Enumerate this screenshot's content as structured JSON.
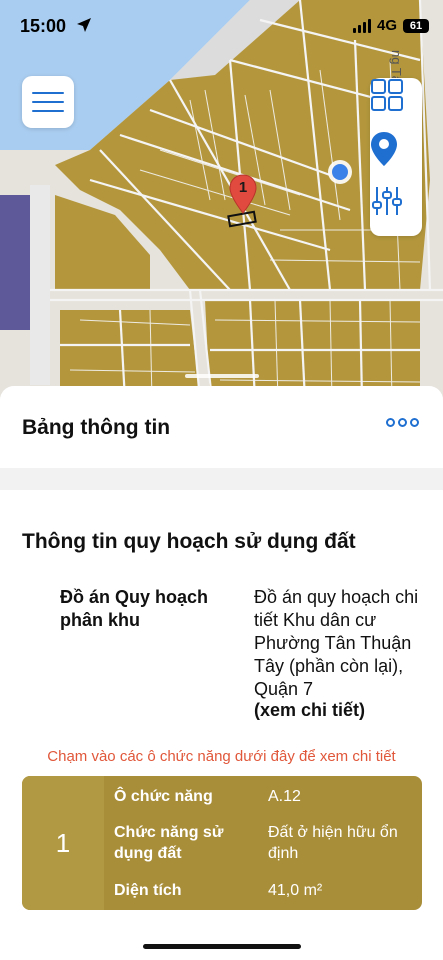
{
  "status_bar": {
    "time": "15:00",
    "network": "4G",
    "battery": "61"
  },
  "map": {
    "street_label": "ng Tân Mỹ",
    "marker_number": "1",
    "colors": {
      "land": "#b4973d",
      "water": "#a9cdf0",
      "road": "#f4f4f4",
      "marker": "#e14b3f",
      "location_dot": "#3a82e8"
    }
  },
  "toolbar": {
    "menu_icon": "hamburger-icon",
    "layers_icon": "grid-icon",
    "location_icon": "location-pin-icon",
    "filter_icon": "sliders-icon"
  },
  "panel": {
    "title": "Bảng thông tin",
    "more_icon": "ellipsis-icon"
  },
  "land_use": {
    "section_title": "Thông tin quy hoạch sử dụng đất",
    "plan_label": "Đồ án Quy hoạch phân khu",
    "plan_value": "Đồ án quy hoạch chi tiết Khu dân cư Phường Tân Thuận Tây (phần còn lại), Quận 7",
    "detail_link": "(xem chi tiết)",
    "hint": "Chạm vào các ô chức năng dưới đây để xem chi tiết"
  },
  "function_card": {
    "index": "1",
    "color": "#a98e3a",
    "rows": [
      {
        "label": "Ô chức năng",
        "value": "A.12"
      },
      {
        "label": "Chức năng sử dụng đất",
        "value": "Đất ở hiện hữu ổn định"
      },
      {
        "label": "Diện tích",
        "value": "41,0 m²"
      }
    ]
  }
}
